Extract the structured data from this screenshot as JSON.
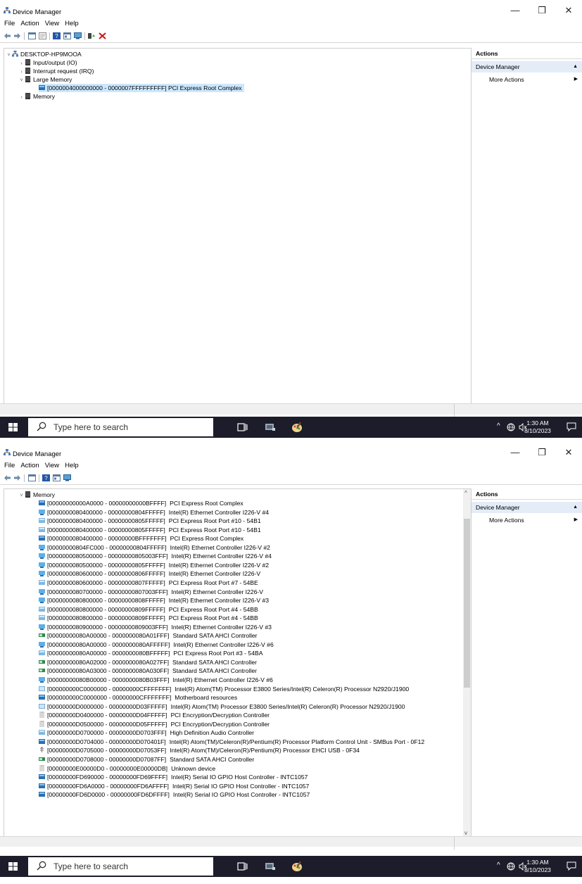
{
  "window": {
    "title": "Device Manager",
    "controls": {
      "minimize": "—",
      "maximize": "❐",
      "close": "✕"
    }
  },
  "menu": [
    "File",
    "Action",
    "View",
    "Help"
  ],
  "actions_pane": {
    "header": "Actions",
    "section": "Device Manager",
    "more": "More Actions"
  },
  "taskbar": {
    "search_placeholder": "Type here to search",
    "time": "1:30 AM",
    "date": "8/10/2023"
  },
  "window1": {
    "tree": [
      {
        "arrow": "˅",
        "label": "DESKTOP-HP9MOOA"
      },
      {
        "arrow": "›",
        "label": "Input/output (IO)"
      },
      {
        "arrow": "›",
        "label": "Interrupt request (IRQ)"
      },
      {
        "arrow": "˅",
        "label": "Large Memory"
      },
      {
        "arrow": "",
        "label": "[0000004000000000 - 0000007FFFFFFFFF]  PCI Express Root Complex",
        "selected": true
      },
      {
        "arrow": "›",
        "label": "Memory"
      }
    ]
  },
  "window2": {
    "root": {
      "arrow": "˅",
      "label": "Memory"
    },
    "items": [
      {
        "range": "[00000000000A0000 - 00000000000BFFFF]",
        "device": "PCI Express Root Complex",
        "icon": "root"
      },
      {
        "range": "[0000000080400000 - 00000000804FFFFF]",
        "device": "Intel(R) Ethernet Controller I226-V #4",
        "icon": "net"
      },
      {
        "range": "[0000000080400000 - 00000000805FFFFF]",
        "device": "PCI Express Root Port #10 - 54B1",
        "icon": "port"
      },
      {
        "range": "[0000000080400000 - 00000000805FFFFF]",
        "device": "PCI Express Root Port #10 - 54B1",
        "icon": "port"
      },
      {
        "range": "[0000000080400000 - 00000000BFFFFFFF]",
        "device": "PCI Express Root Complex",
        "icon": "root"
      },
      {
        "range": "[00000000804FC000 - 00000000804FFFFF]",
        "device": "Intel(R) Ethernet Controller I226-V #2",
        "icon": "net"
      },
      {
        "range": "[0000000080500000 - 00000000805003FFF]",
        "device": "Intel(R) Ethernet Controller I226-V #4",
        "icon": "net"
      },
      {
        "range": "[0000000080500000 - 00000000805FFFFF]",
        "device": "Intel(R) Ethernet Controller I226-V #2",
        "icon": "net"
      },
      {
        "range": "[0000000080600000 - 00000000806FFFFF]",
        "device": "Intel(R) Ethernet Controller I226-V",
        "icon": "net"
      },
      {
        "range": "[0000000080600000 - 00000000807FFFFF]",
        "device": "PCI Express Root Port #7 - 54BE",
        "icon": "port"
      },
      {
        "range": "[0000000080700000 - 00000000807003FFF]",
        "device": "Intel(R) Ethernet Controller I226-V",
        "icon": "net"
      },
      {
        "range": "[0000000080800000 - 00000000808FFFFF]",
        "device": "Intel(R) Ethernet Controller I226-V #3",
        "icon": "net"
      },
      {
        "range": "[0000000080800000 - 00000000809FFFFF]",
        "device": "PCI Express Root Port #4 - 54BB",
        "icon": "port"
      },
      {
        "range": "[0000000080800000 - 00000000809FFFFF]",
        "device": "PCI Express Root Port #4 - 54BB",
        "icon": "port"
      },
      {
        "range": "[0000000080900000 - 00000000809003FFF]",
        "device": "Intel(R) Ethernet Controller I226-V #3",
        "icon": "net"
      },
      {
        "range": "[00000000080A00000 - 0000000080A01FFF]",
        "device": "Standard SATA AHCI Controller",
        "icon": "sata"
      },
      {
        "range": "[00000000080A00000 - 0000000080AFFFFF]",
        "device": "Intel(R) Ethernet Controller I226-V #6",
        "icon": "net"
      },
      {
        "range": "[00000000080A00000 - 0000000080BFFFFF]",
        "device": "PCI Express Root Port #3 - 54BA",
        "icon": "port"
      },
      {
        "range": "[00000000080A02000 - 0000000080A027FF]",
        "device": "Standard SATA AHCI Controller",
        "icon": "sata"
      },
      {
        "range": "[00000000080A03000 - 0000000080A030FF]",
        "device": "Standard SATA AHCI Controller",
        "icon": "sata"
      },
      {
        "range": "[00000000080B00000 - 0000000080B03FFF]",
        "device": "Intel(R) Ethernet Controller I226-V #6",
        "icon": "net"
      },
      {
        "range": "[000000000C0000000 - 00000000CFFFFFFF]",
        "device": "Intel(R) Atom(TM) Processor E3800 Series/Intel(R) Celeron(R) Processor N2920/J1900",
        "icon": "sys"
      },
      {
        "range": "[000000000C0000000 - 00000000CFFFFFFF]",
        "device": "Motherboard resources",
        "icon": "root"
      },
      {
        "range": "[00000000D0000000 - 00000000D03FFFFF]",
        "device": "Intel(R) Atom(TM) Processor E3800 Series/Intel(R) Celeron(R) Processor N2920/J1900",
        "icon": "sys"
      },
      {
        "range": "[00000000D0400000 - 00000000D04FFFFF]",
        "device": "PCI Encryption/Decryption Controller",
        "icon": "unk"
      },
      {
        "range": "[00000000D0500000 - 00000000D05FFFFF]",
        "device": "PCI Encryption/Decryption Controller",
        "icon": "unk"
      },
      {
        "range": "[00000000D0700000 - 00000000D0703FFF]",
        "device": "High Definition Audio Controller",
        "icon": "port"
      },
      {
        "range": "[00000000D0704000 - 00000000D070401F]",
        "device": "Intel(R) Atom(TM)/Celeron(R)/Pentium(R) Processor Platform Control Unit - SMBus Port - 0F12",
        "icon": "root"
      },
      {
        "range": "[00000000D0705000 - 00000000D07053FF]",
        "device": "Intel(R) Atom(TM)/Celeron(R)/Pentium(R) Processor EHCI USB - 0F34",
        "icon": "usb"
      },
      {
        "range": "[00000000D0708000 - 00000000D07087FF]",
        "device": "Standard SATA AHCI Controller",
        "icon": "sata"
      },
      {
        "range": "[00000000E00000D0 - 00000000E00000DB]",
        "device": "Unknown device",
        "icon": "unk"
      },
      {
        "range": "[00000000FD690000 - 00000000FD69FFFF]",
        "device": "Intel(R) Serial IO GPIO Host Controller - INTC1057",
        "icon": "root"
      },
      {
        "range": "[00000000FD6A0000 - 00000000FD6AFFFF]",
        "device": "Intel(R) Serial IO GPIO Host Controller - INTC1057",
        "icon": "root"
      },
      {
        "range": "[00000000FD6D0000 - 00000000FD6DFFFF]",
        "device": "Intel(R) Serial IO GPIO Host Controller - INTC1057",
        "icon": "root"
      }
    ]
  },
  "icons": {
    "root": "pci-root-icon",
    "net": "network-adapter-icon",
    "port": "pci-port-icon",
    "sata": "storage-controller-icon",
    "sys": "system-device-icon",
    "unk": "unknown-device-icon",
    "usb": "usb-icon"
  },
  "colors": {
    "selection": "#cce8ff",
    "taskbar": "#1c1c2a",
    "accent": "#0078d7",
    "close_icon": "#d11515"
  }
}
